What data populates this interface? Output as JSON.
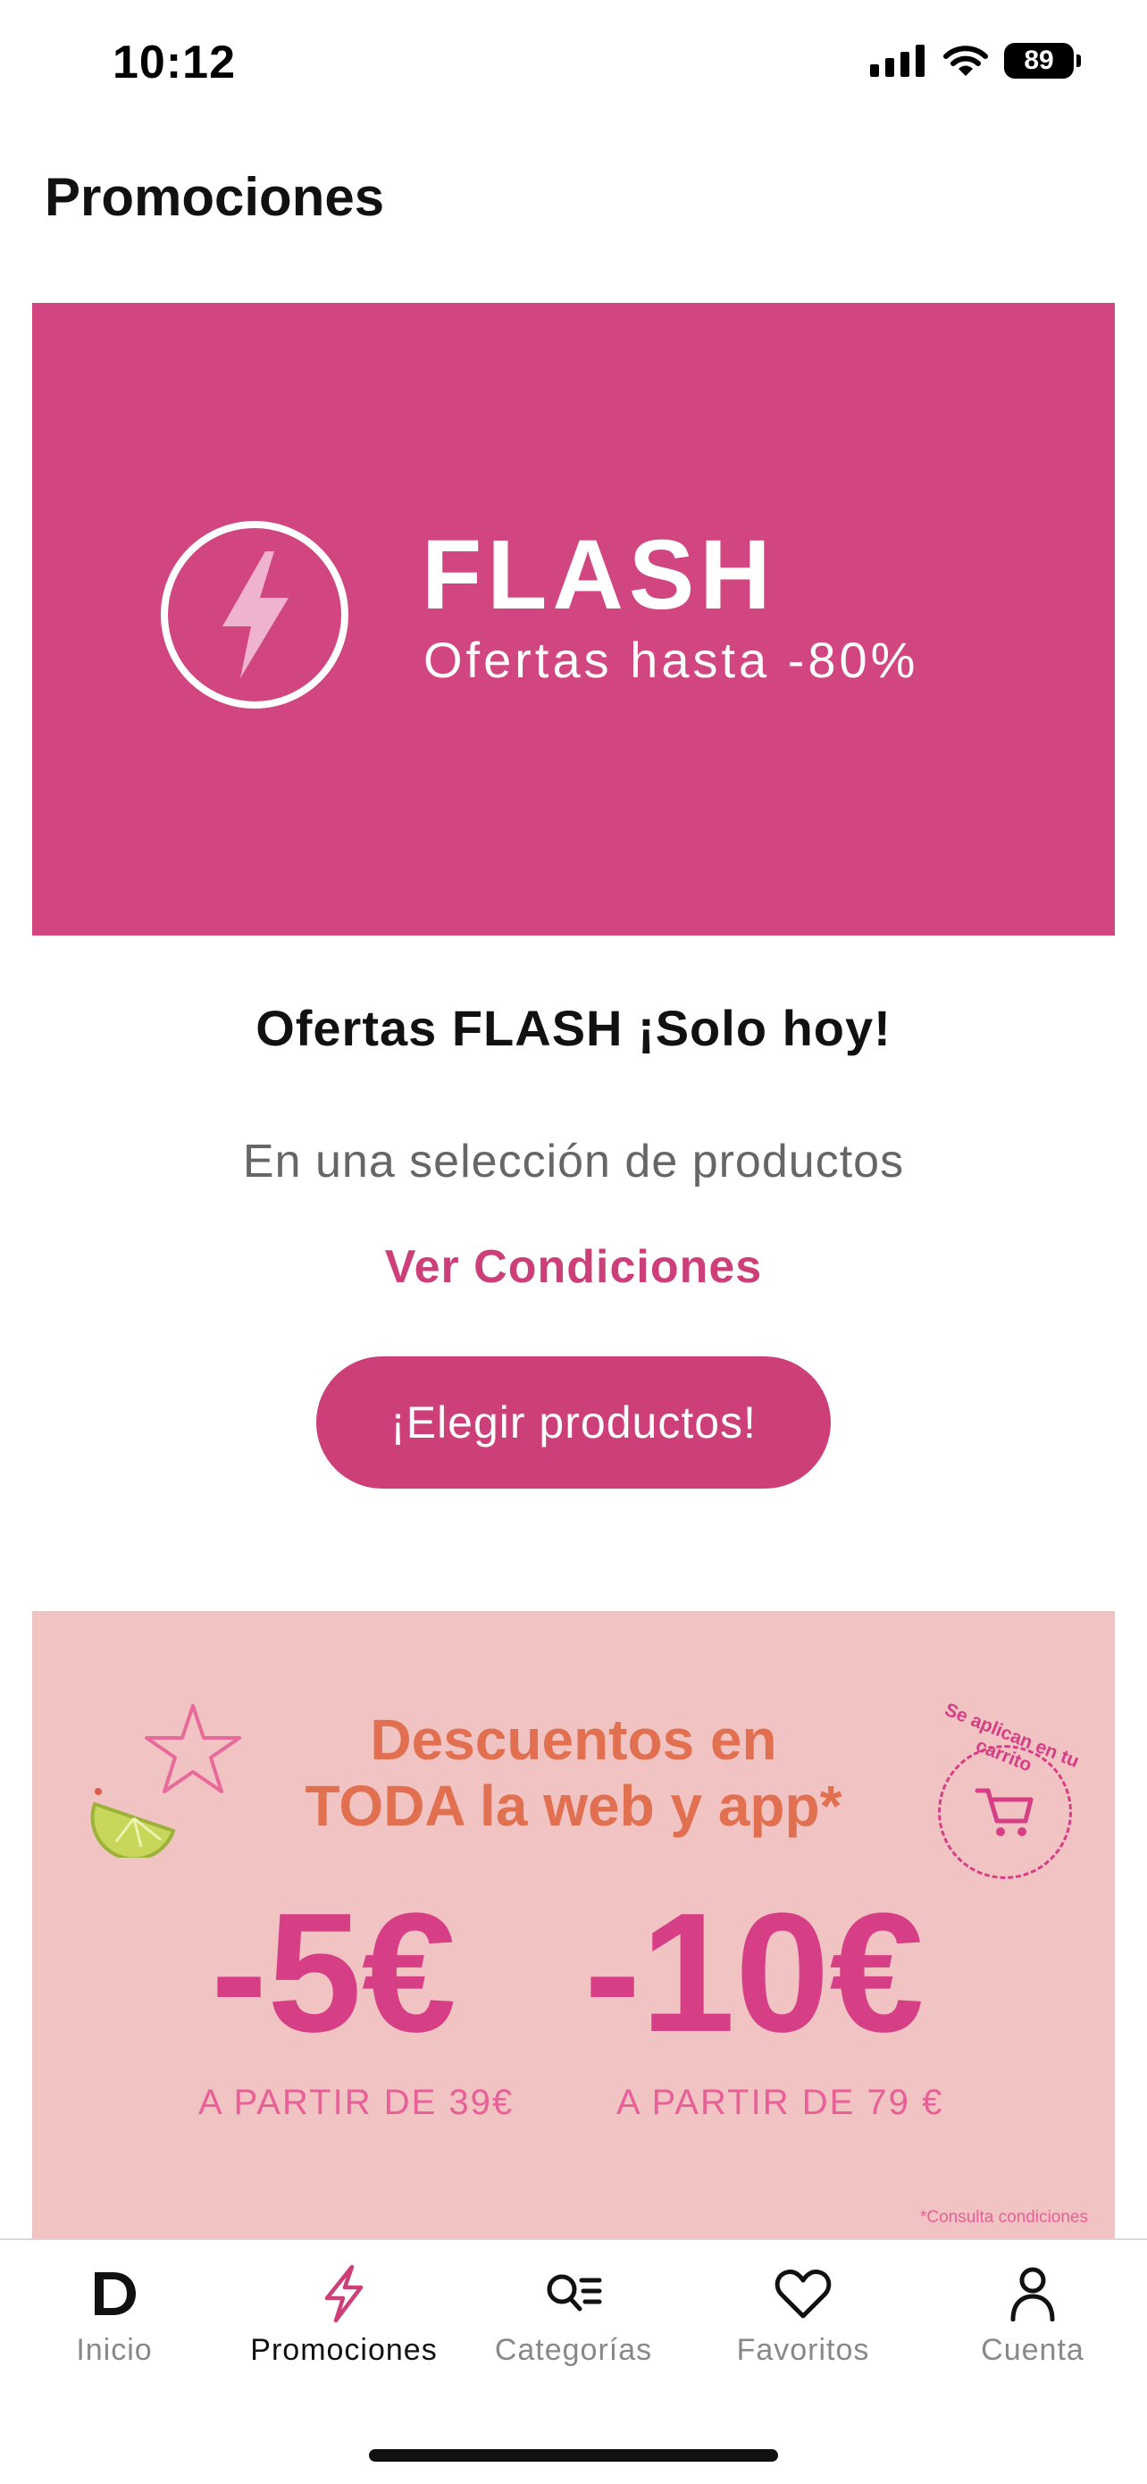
{
  "status_bar": {
    "time": "10:12",
    "battery": "89"
  },
  "page": {
    "title": "Promociones"
  },
  "flash_banner": {
    "title": "FLASH",
    "subtitle": "Ofertas hasta -80%"
  },
  "offer": {
    "title": "Ofertas FLASH ¡Solo hoy!",
    "description": "En una selección de productos",
    "conditions_link": "Ver Condiciones",
    "button_label": "¡Elegir productos!"
  },
  "discount_banner": {
    "headline_line1": "Descuentos en",
    "headline_line2": "TODA la web y app*",
    "badge_text": "Se aplican en tu carrito",
    "offer1_amount": "-5€",
    "offer1_min": "A PARTIR DE 39€",
    "offer2_amount": "-10€",
    "offer2_min": "A PARTIR DE 79 €",
    "footnote": "*Consulta condiciones"
  },
  "tab_bar": {
    "items": [
      {
        "label": "Inicio",
        "icon": "logo-d-icon"
      },
      {
        "label": "Promociones",
        "icon": "bolt-icon",
        "active": true
      },
      {
        "label": "Categorías",
        "icon": "search-list-icon"
      },
      {
        "label": "Favoritos",
        "icon": "heart-icon"
      },
      {
        "label": "Cuenta",
        "icon": "person-icon"
      }
    ]
  },
  "colors": {
    "brand_pink": "#d14681",
    "button_pink": "#cc3f79",
    "promo_bg": "#f2c3c3",
    "orange": "#e0704f"
  }
}
